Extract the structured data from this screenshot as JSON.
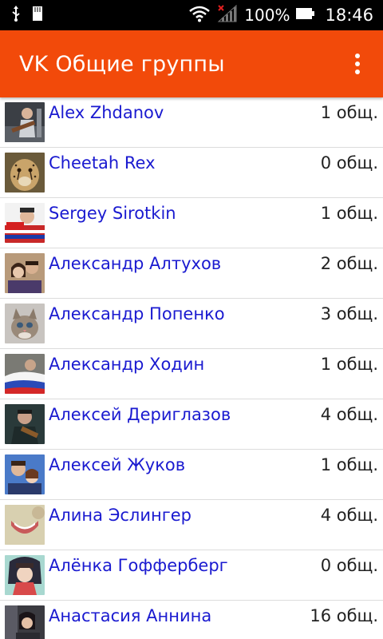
{
  "status_bar": {
    "battery_percent": "100%",
    "time": "18:46",
    "icons": [
      "usb-icon",
      "sd-card-icon",
      "wifi-icon",
      "signal-no-sim-icon",
      "battery-icon"
    ]
  },
  "app_bar": {
    "title": "VK Общие группы",
    "background_color": "#f24a0a",
    "menu_icon": "overflow-menu-icon"
  },
  "contacts": [
    {
      "name": "Alex Zhdanov",
      "common": "1 общ."
    },
    {
      "name": "Cheetah Rex",
      "common": "0 общ."
    },
    {
      "name": "Sergey Sirotkin",
      "common": "1 общ."
    },
    {
      "name": "Александр Алтухов",
      "common": "2 общ."
    },
    {
      "name": "Александр Попенко",
      "common": "3 общ."
    },
    {
      "name": "Александр Ходин",
      "common": "1 общ."
    },
    {
      "name": "Алексей Дериглазов",
      "common": "4 общ."
    },
    {
      "name": "Алексей Жуков",
      "common": "1 общ."
    },
    {
      "name": "Алина Эслингер",
      "common": "4 общ."
    },
    {
      "name": "Алёнка Гофферберг",
      "common": "0 общ."
    },
    {
      "name": "Анастасия Аннина",
      "common": "16 общ."
    }
  ],
  "colors": {
    "name_text": "#1a1ad0",
    "count_text": "#222222",
    "divider": "#dcdcdc"
  }
}
